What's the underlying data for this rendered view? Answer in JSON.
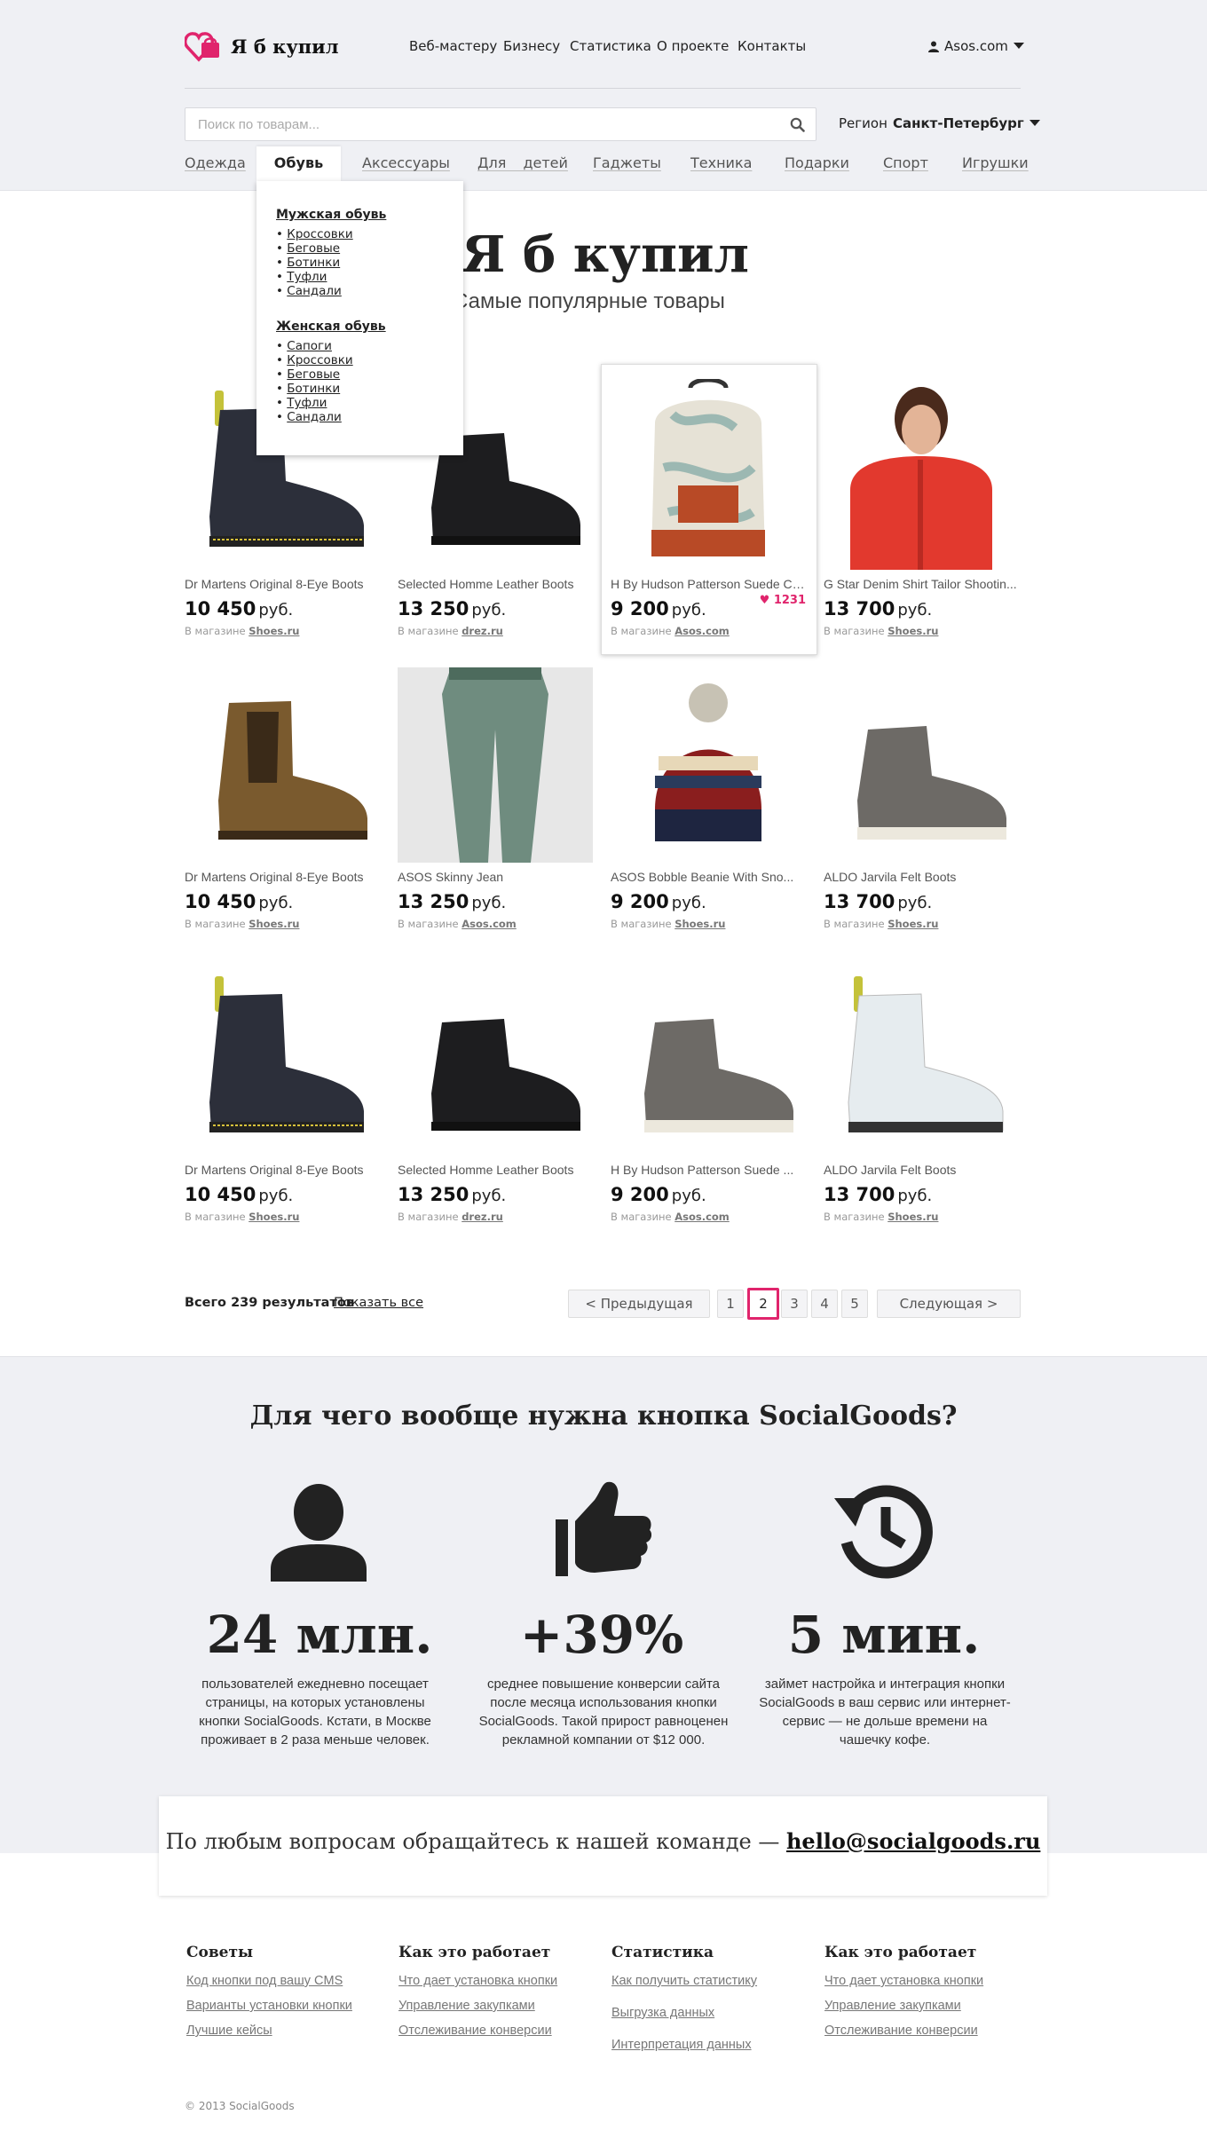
{
  "header": {
    "logo_text": "Я б купил",
    "nav": [
      "Веб-мастеру",
      "Бизнесу",
      "Статистика",
      "О проекте",
      "Контакты"
    ],
    "account": "Asos.com"
  },
  "search": {
    "placeholder": "Поиск по товарам...",
    "region_label": "Регион",
    "region_value": "Санкт-Петербург"
  },
  "categories": {
    "items": [
      "Одежда",
      "Обувь",
      "Аксессуары",
      "Для детей",
      "Гаджеты",
      "Техника",
      "Подарки",
      "Спорт",
      "Игрушки"
    ],
    "active": "Обувь"
  },
  "dropdown": {
    "men_title": "Мужская обувь",
    "men_items": [
      "Кроссовки",
      "Беговые",
      "Ботинки",
      "Туфли",
      "Сандали"
    ],
    "women_title": "Женская обувь",
    "women_items": [
      "Сапоги",
      "Кроссовки",
      "Беговые",
      "Ботинки",
      "Туфли",
      "Сандали"
    ]
  },
  "hero": {
    "title": "Я б купил",
    "subtitle": "Самые популярные товары"
  },
  "products": [
    {
      "name": "Dr Martens Original 8-Eye Boots",
      "price": "10 450",
      "currency": "руб.",
      "store_prefix": "В магазине",
      "store": "Shoes.ru",
      "image": "black-boot-icon"
    },
    {
      "name": "Selected Homme Leather Boots",
      "price": "13 250",
      "currency": "руб.",
      "store_prefix": "В магазине",
      "store": "drez.ru",
      "image": "black-shoe-icon"
    },
    {
      "name": "H By Hudson Patterson Suede Ch...",
      "price": "9 200",
      "currency": "руб.",
      "store_prefix": "В магазине",
      "store": "Asos.com",
      "image": "backpack-icon",
      "likes": "1231"
    },
    {
      "name": "G Star Denim Shirt Tailor Shootin...",
      "price": "13 700",
      "currency": "руб.",
      "store_prefix": "В магазине",
      "store": "Shoes.ru",
      "image": "red-shirt-icon"
    },
    {
      "name": "Dr Martens Original 8-Eye Boots",
      "price": "10 450",
      "currency": "руб.",
      "store_prefix": "В магазине",
      "store": "Shoes.ru",
      "image": "chelsea-boot-icon"
    },
    {
      "name": "ASOS Skinny Jean",
      "price": "13 250",
      "currency": "руб.",
      "store_prefix": "В магазине",
      "store": "Asos.com",
      "image": "jeans-icon"
    },
    {
      "name": "ASOS Bobble Beanie With Sno...",
      "price": "9 200",
      "currency": "руб.",
      "store_prefix": "В магазине",
      "store": "Shoes.ru",
      "image": "beanie-icon"
    },
    {
      "name": "ALDO Jarvila Felt Boots",
      "price": "13 700",
      "currency": "руб.",
      "store_prefix": "В магазине",
      "store": "Shoes.ru",
      "image": "grey-boot-icon"
    },
    {
      "name": "Dr Martens Original 8-Eye Boots",
      "price": "10 450",
      "currency": "руб.",
      "store_prefix": "В магазине",
      "store": "Shoes.ru",
      "image": "black-boot-icon"
    },
    {
      "name": "Selected Homme Leather Boots",
      "price": "13 250",
      "currency": "руб.",
      "store_prefix": "В магазине",
      "store": "drez.ru",
      "image": "black-shoe-icon"
    },
    {
      "name": "H By Hudson Patterson Suede ...",
      "price": "9 200",
      "currency": "руб.",
      "store_prefix": "В магазине",
      "store": "Asos.com",
      "image": "grey-boot-icon"
    },
    {
      "name": "ALDO Jarvila Felt Boots",
      "price": "13 700",
      "currency": "руб.",
      "store_prefix": "В магазине",
      "store": "Shoes.ru",
      "image": "white-boot-icon"
    }
  ],
  "pagination": {
    "total": "Всего 239 результатов",
    "show_all": "Показать все",
    "prev": "< Предыдущая",
    "pages": [
      "1",
      "2",
      "3",
      "4",
      "5"
    ],
    "current": "2",
    "next": "Следующая >"
  },
  "why": {
    "title": "Для чего вообще нужна кнопка SocialGoods?",
    "stats": [
      {
        "value": "24 млн.",
        "text": "пользователей ежедневно посещает страницы, на которых установлены кнопки SocialGoods. Кстати, в Москве проживает в 2 раза меньше человек.",
        "icon": "user-icon"
      },
      {
        "value": "+39%",
        "text": "среднее повышение конверсии сайта после месяца использования кнопки SocialGoods. Такой прирост равноценен рекламной компании от $12 000.",
        "icon": "thumbs-up-icon"
      },
      {
        "value": "5 мин.",
        "text": "займет настройка и интеграция кнопки SocialGoods в ваш сервис или интернет-сервис — не дольше времени на чашечку кофе.",
        "icon": "history-icon"
      }
    ]
  },
  "contact": {
    "text": "По любым вопросам обращайтесь к нашей команде —",
    "email": "hello@socialgoods.ru"
  },
  "footer": {
    "columns": [
      {
        "title": "Советы",
        "links": [
          "Код кнопки под вашу CMS",
          "Варианты установки кнопки",
          "Лучшие кейсы"
        ]
      },
      {
        "title": "Как это работает",
        "links": [
          "Что дает установка кнопки",
          "Управление закупками",
          "Отслеживание конверсии"
        ]
      },
      {
        "title": "Статистика",
        "links": [
          "Как получить статистику",
          "Выгрузка данных",
          "Интерпретация данных"
        ]
      },
      {
        "title": "Как это работает",
        "links": [
          "Что дает установка кнопки",
          "Управление закупками",
          "Отслеживание конверсии"
        ]
      }
    ],
    "copyright": "© 2013 SocialGoods"
  },
  "colors": {
    "accent": "#e0246c",
    "background": "#eff0f4"
  }
}
